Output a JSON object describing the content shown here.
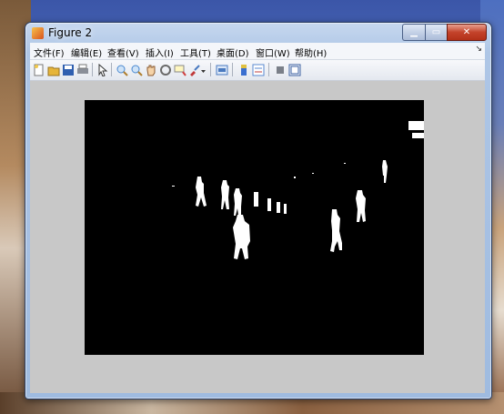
{
  "window": {
    "title": "Figure 2"
  },
  "menu": [
    {
      "id": "file",
      "label": "文件(F)"
    },
    {
      "id": "edit",
      "label": "编辑(E)"
    },
    {
      "id": "view",
      "label": "查看(V)"
    },
    {
      "id": "insert",
      "label": "插入(I)"
    },
    {
      "id": "tools",
      "label": "工具(T)"
    },
    {
      "id": "desktop",
      "label": "桌面(D)"
    },
    {
      "id": "window",
      "label": "窗口(W)"
    },
    {
      "id": "help",
      "label": "帮助(H)"
    }
  ],
  "toolbar": [
    {
      "name": "new-figure-icon",
      "color": "#f2c94c"
    },
    {
      "name": "open-file-icon",
      "color": "#e6b53a"
    },
    {
      "name": "save-icon",
      "color": "#2f5fb0"
    },
    {
      "name": "print-icon",
      "color": "#8a8f99"
    },
    {
      "name": "pointer-icon",
      "color": "#333333"
    },
    {
      "name": "zoom-in-icon",
      "color": "#4a88d0"
    },
    {
      "name": "zoom-out-icon",
      "color": "#4a88d0"
    },
    {
      "name": "pan-icon",
      "color": "#d9a060"
    },
    {
      "name": "rotate-3d-icon",
      "color": "#6a6a6a"
    },
    {
      "name": "data-cursor-icon",
      "color": "#d04040"
    },
    {
      "name": "brush-icon",
      "color": "#c03a3a"
    },
    {
      "name": "link-plot-icon",
      "color": "#4a7ac0"
    },
    {
      "name": "colorbar-icon",
      "color": "#3a6fd0"
    },
    {
      "name": "legend-icon",
      "color": "#5a8ad0"
    },
    {
      "name": "hide-plot-tools-icon",
      "color": "#7a7f88"
    },
    {
      "name": "show-plot-tools-icon",
      "color": "#3a5fa0"
    }
  ],
  "colors": {
    "image_background": "#000000",
    "figure_background": "#c8c8c8",
    "foreground": "#ffffff"
  }
}
